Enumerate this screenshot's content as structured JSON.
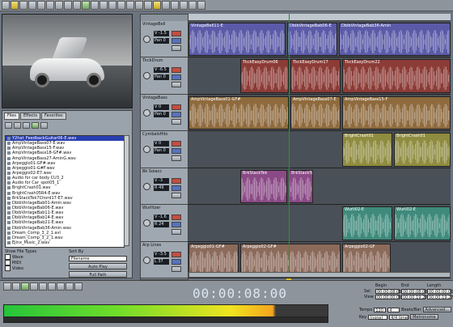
{
  "browser": {
    "tabs": [
      "Files",
      "Effects",
      "Favorites"
    ],
    "files": [
      "Y2hat_FeedbackGuitar06-E.wav",
      "AmpVintageBass07-E.wav",
      "AmpVintageBass15-F.wav",
      "AmpVintageBass18-GF#.wav",
      "AmpVintageBass27-AminG.wav",
      "Arpeggio01-GF#.wav",
      "Arpeggio01-G#F.wav",
      "Arpeggio02-E7.wav",
      "Audio for car body CU3_2",
      "Audio for Car_spot05_1",
      "BrightCrash01.wav",
      "BrightCrash05R4-E.wav",
      "BrkStackTek7Chord17-E7.wav",
      "DbibVintageBab01-Amin.wav",
      "DbibVintageBab06-E.wav",
      "DbibVintageBab11-E.wav",
      "DbibVintageBab14-E.wav",
      "DbibVintageBab21-E.wav",
      "DbibVintageBab36-Amin.wav",
      "Dream_Comp_3_2_1.avi",
      "Dream_Comp_3_2_1.wav",
      "Ejinx_Music_2.wav"
    ],
    "show_types_label": "Show File Types",
    "types": [
      "Wave",
      "MIDI",
      "Video"
    ],
    "sort_by_label": "Sort By",
    "sort_value": "Filename",
    "auto_play": "Auto Play",
    "full_pathl": "Full Path"
  },
  "tracks": [
    {
      "name": "VintageBell",
      "vol": "V -1.5",
      "pan": "Pan 0"
    },
    {
      "name": "TkckDrum",
      "vol": "V -6.5",
      "pan": "Pan 0"
    },
    {
      "name": "VintageBass",
      "vol": "V 0",
      "pan": "Pan 0"
    },
    {
      "name": "CymbalsHits",
      "vol": "V 0",
      "pan": "Pan 0"
    },
    {
      "name": "Bk Solacc",
      "vol": "V -3",
      "pan": "R 49"
    },
    {
      "name": "Wurlitzer",
      "vol": "V -1.6",
      "pan": "R 24"
    },
    {
      "name": "Arp Lines",
      "vol": "V -3.5",
      "pan": "L 37"
    }
  ],
  "clips": [
    {
      "lane": 0,
      "label": "VintageBell11-E",
      "color": "#5a5aa8"
    },
    {
      "lane": 0,
      "label": "DbibVintageBab06-E",
      "color": "#5a5aa8"
    },
    {
      "lane": 0,
      "label": "DbibVintageBab36-Amin",
      "color": "#5a5aa8"
    },
    {
      "lane": 1,
      "label": "TkckEasyDrum06",
      "color": "#8c3b36"
    },
    {
      "lane": 1,
      "label": "TkckEasyDrum17",
      "color": "#8c3b36"
    },
    {
      "lane": 1,
      "label": "TkckEasyDrum22",
      "color": "#8c3b36"
    },
    {
      "lane": 2,
      "label": "AmpVintageBass01-GF#",
      "color": "#8e6a3d"
    },
    {
      "lane": 2,
      "label": "AmpVintageBass07-E",
      "color": "#8e6a3d"
    },
    {
      "lane": 2,
      "label": "AmpVintageBass15-F",
      "color": "#8e6a3d"
    },
    {
      "lane": 3,
      "label": "BrightCrash01",
      "color": "#8f8c3f"
    },
    {
      "lane": 3,
      "label": "BrightCrash01",
      "color": "#8f8c3f"
    },
    {
      "lane": 4,
      "label": "BrkStackTek",
      "color": "#8a4a86"
    },
    {
      "lane": 4,
      "label": "BrkStackTek",
      "color": "#8a4a86"
    },
    {
      "lane": 5,
      "label": "Wurli02-E",
      "color": "#3f8a7c"
    },
    {
      "lane": 5,
      "label": "Wurli02-E",
      "color": "#3f8a7c"
    },
    {
      "lane": 6,
      "label": "Arpeggio01-GF#",
      "color": "#8b6a5a"
    },
    {
      "lane": 6,
      "label": "Arpeggio02-GF#",
      "color": "#8b6a5a"
    },
    {
      "lane": 6,
      "label": "Arpeggio02-GF",
      "color": "#8b6a5a"
    }
  ],
  "transport": {
    "time": "00:00:08:00",
    "begin_label": "Begin",
    "end_label": "End",
    "length_label": "Length",
    "sel_label": "Sel",
    "view_label": "View",
    "sel_begin": "00:00:08:00",
    "sel_end": "00:00:08:00",
    "sel_length": "00:00:00:00",
    "view_begin": "00:00:00:00",
    "view_end": "00:00:19:27",
    "view_length": "00:00:19:27",
    "tempo_label": "Tempo",
    "tempo": "120",
    "beats_label": "Beats/Bar",
    "beats": "4",
    "key_label": "Key",
    "key": "(none)",
    "meter": "4/4 time",
    "advanced": "Advanced...",
    "metronome": "Metronome"
  }
}
